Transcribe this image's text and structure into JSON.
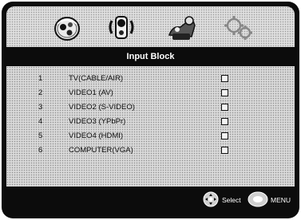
{
  "menu_icons": [
    {
      "name": "picture-icon"
    },
    {
      "name": "audio-icon"
    },
    {
      "name": "parental-icon"
    },
    {
      "name": "setup-icon"
    }
  ],
  "title": "Input Block",
  "items": [
    {
      "num": "1",
      "label": "TV(CABLE/AIR)"
    },
    {
      "num": "2",
      "label": "VIDEO1 (AV)"
    },
    {
      "num": "3",
      "label": "VIDEO2 (S-VIDEO)"
    },
    {
      "num": "4",
      "label": "VIDEO3 (YPbPr)"
    },
    {
      "num": "5",
      "label": "VIDEO4 (HDMI)"
    },
    {
      "num": "6",
      "label": "COMPUTER(VGA)"
    }
  ],
  "footer": {
    "select_label": "Select",
    "menu_label": "MENU",
    "select_icon": "dpad-icon",
    "menu_icon": "menu-button-icon"
  }
}
